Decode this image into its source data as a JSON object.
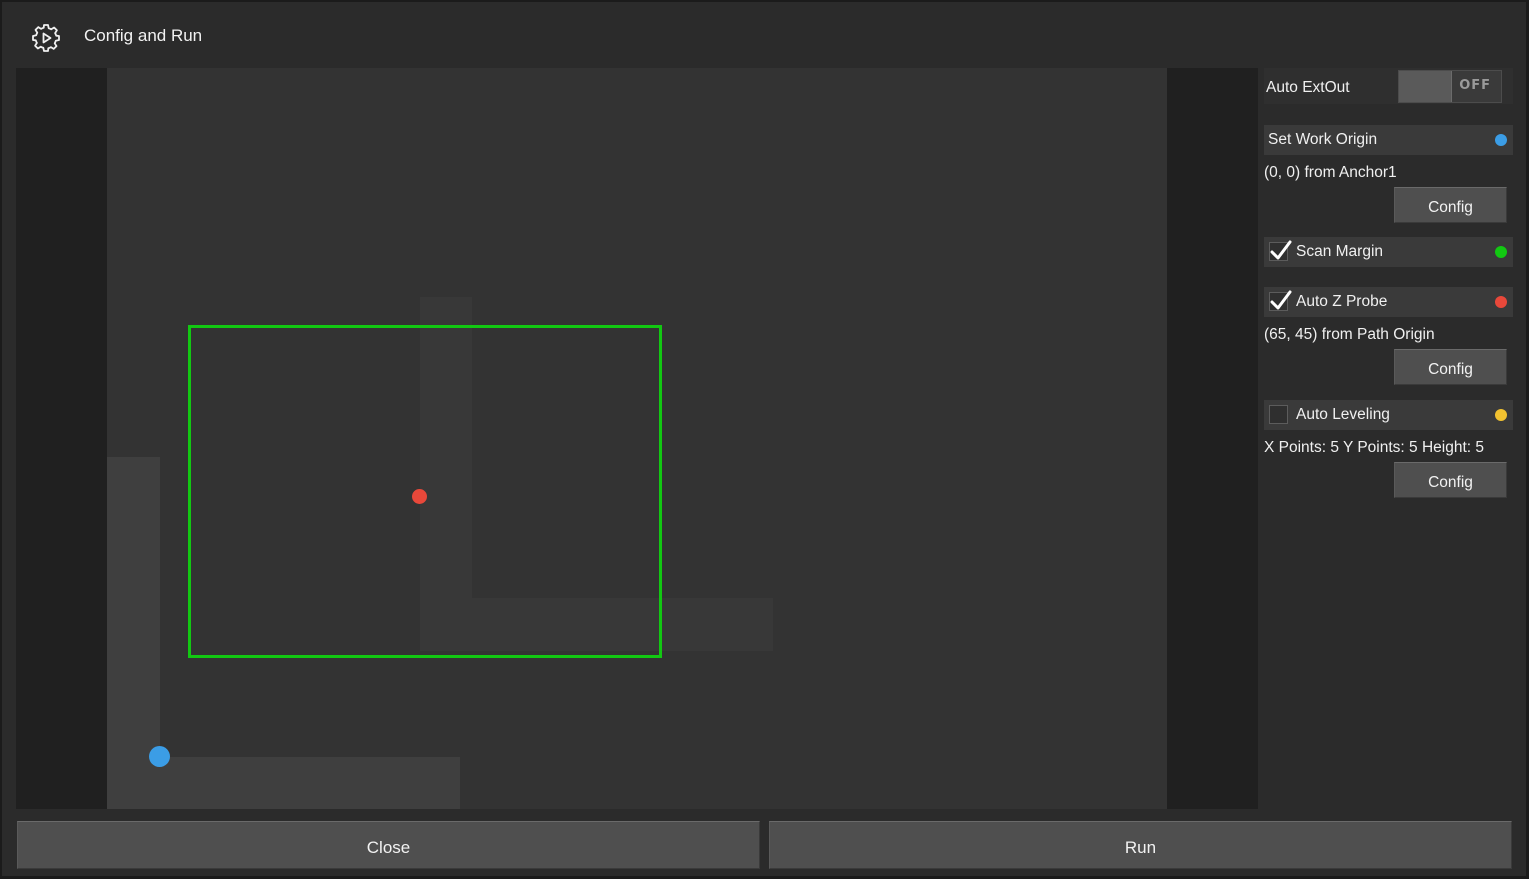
{
  "window": {
    "title": "Config and Run",
    "icon": "gear-play-icon"
  },
  "preview": {
    "work_origin_color": "#3b9de6",
    "z_probe_color": "#e8483a",
    "scan_margin_color": "#12c812"
  },
  "side": {
    "auto_extout": {
      "label": "Auto ExtOut",
      "state": "OFF",
      "on": false
    },
    "set_work_origin": {
      "label": "Set Work Origin",
      "indicator_color": "#3b9de6",
      "info": "(0, 0) from Anchor1",
      "button": "Config"
    },
    "scan_margin": {
      "label": "Scan Margin",
      "checked": true,
      "indicator_color": "#12c812"
    },
    "auto_z_probe": {
      "label": "Auto Z Probe",
      "checked": true,
      "indicator_color": "#e8483a",
      "info": "(65, 45) from Path Origin",
      "button": "Config"
    },
    "auto_leveling": {
      "label": "Auto Leveling",
      "checked": false,
      "indicator_color": "#f2c230",
      "info": "X Points: 5 Y Points: 5 Height: 5",
      "button": "Config"
    }
  },
  "footer": {
    "close_label": "Close",
    "run_label": "Run"
  }
}
